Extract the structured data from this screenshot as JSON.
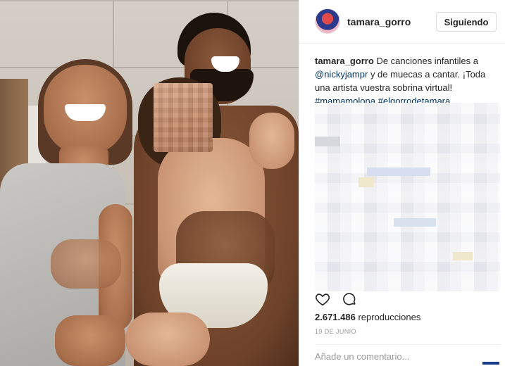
{
  "post": {
    "username": "tamara_gorro",
    "follow_label": "Siguiendo",
    "caption": {
      "username": "tamara_gorro",
      "text_1": " De canciones infantiles a ",
      "mention": "@nickyjampr",
      "text_2": " y de muecas a cantar. ¡Toda una artista vuestra sobrina virtual! ",
      "hashtag_1": "#mamamolona",
      "hashtag_2": "#elgorrodetamara"
    },
    "views_count": "2.671.486",
    "views_label": " reproducciones",
    "date": "19 DE JUNIO",
    "comment_placeholder": "Añade un comentario..."
  },
  "icons": {
    "like": "heart-icon",
    "comment": "comment-bubble-icon",
    "avatar": "profile-avatar"
  },
  "colors": {
    "link": "#003569",
    "text": "#262626",
    "muted": "#999999",
    "border": "#efefef"
  }
}
